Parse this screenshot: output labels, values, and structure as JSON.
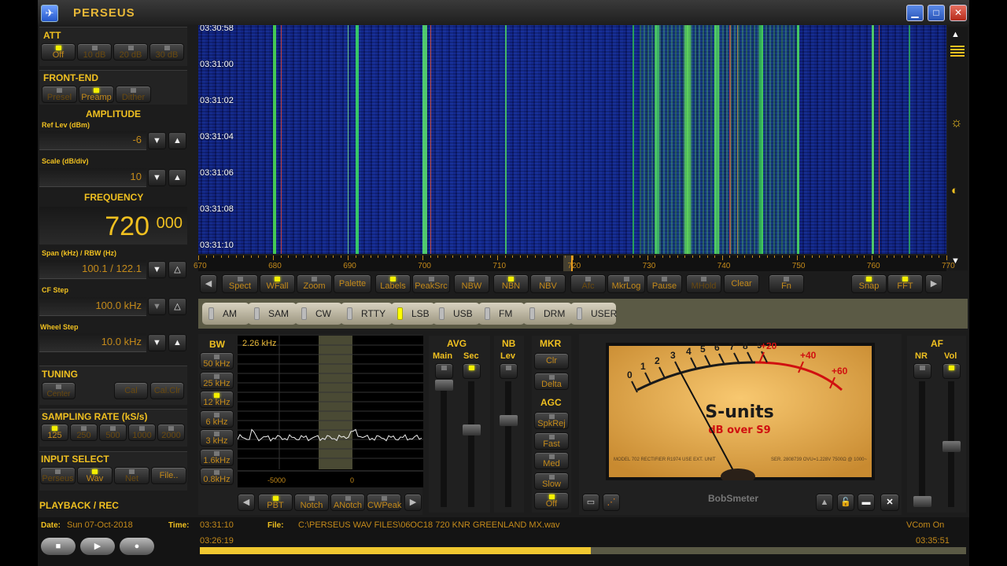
{
  "app": {
    "title": "PERSEUS",
    "icon": "app-logo-icon",
    "window_buttons": [
      "minimize",
      "maximize",
      "close"
    ]
  },
  "left": {
    "att": {
      "title": "ATT",
      "buttons": [
        {
          "label": "Off",
          "on": true
        },
        {
          "label": "10 dB",
          "on": false
        },
        {
          "label": "20 dB",
          "on": false
        },
        {
          "label": "30 dB",
          "on": false
        }
      ]
    },
    "frontend": {
      "title": "FRONT-END",
      "buttons": [
        {
          "label": "Presel",
          "on": false
        },
        {
          "label": "Preamp",
          "on": true
        },
        {
          "label": "Dither",
          "on": false
        }
      ]
    },
    "amplitude": {
      "title": "AMPLITUDE",
      "ref_label": "Ref Lev (dBm)",
      "ref_value": "-6",
      "scale_label": "Scale (dB/div)",
      "scale_value": "10"
    },
    "frequency": {
      "title": "FREQUENCY",
      "khz": "720",
      "hz": "000",
      "span_label": "Span (kHz) / RBW (Hz)",
      "span_value": "100.1 / 122.1",
      "cf_label": "CF Step",
      "cf_value": "100.0 kHz",
      "wheel_label": "Wheel Step",
      "wheel_value": "10.0 kHz"
    },
    "tuning": {
      "title": "TUNING",
      "buttons": [
        {
          "label": "Center"
        },
        {
          "label": "Cal"
        },
        {
          "label": "Cal.Clr"
        }
      ]
    },
    "sampling": {
      "title": "SAMPLING RATE (kS/s)",
      "buttons": [
        {
          "label": "125",
          "on": true
        },
        {
          "label": "250",
          "on": false
        },
        {
          "label": "500",
          "on": false
        },
        {
          "label": "1000",
          "on": false
        },
        {
          "label": "2000",
          "on": false
        }
      ]
    },
    "input": {
      "title": "INPUT SELECT",
      "buttons": [
        {
          "label": "Perseus",
          "on": false
        },
        {
          "label": "Wav",
          "on": true
        },
        {
          "label": "Net",
          "on": false
        },
        {
          "label": "File.."
        }
      ]
    },
    "playback": {
      "title": "PLAYBACK / REC"
    }
  },
  "waterfall": {
    "times": [
      "03:30:58",
      "03:31:00",
      "03:31:02",
      "03:31:04",
      "03:31:06",
      "03:31:08",
      "03:31:10"
    ],
    "freq_ticks": [
      "670",
      "680",
      "690",
      "700",
      "710",
      "720",
      "730",
      "740",
      "750",
      "760",
      "770"
    ],
    "tuned_khz": 720
  },
  "toolbar": [
    {
      "label": "Spect",
      "on": false
    },
    {
      "label": "WFall",
      "on": true
    },
    {
      "label": "Zoom",
      "on": false
    },
    {
      "label": "Palette"
    },
    {
      "label": "Labels",
      "on": true
    },
    {
      "label": "PeakSrc",
      "on": false
    },
    {
      "label": "NBW",
      "on": false
    },
    {
      "label": "NBN",
      "on": true
    },
    {
      "label": "NBV",
      "on": false
    },
    {
      "label": "Afc",
      "on": false,
      "dim": true
    },
    {
      "label": "MkrLog",
      "on": false
    },
    {
      "label": "Pause",
      "on": false
    },
    {
      "label": "MHold",
      "on": false,
      "dim": true
    },
    {
      "label": "Clear"
    },
    {
      "label": "Fn",
      "on": false
    },
    {
      "label": "Snap",
      "on": true
    },
    {
      "label": "FFT",
      "on": true
    }
  ],
  "modes": [
    {
      "label": "AM",
      "on": false
    },
    {
      "label": "SAM",
      "on": false
    },
    {
      "label": "CW",
      "on": false
    },
    {
      "label": "RTTY",
      "on": false
    },
    {
      "label": "LSB",
      "on": true
    },
    {
      "label": "USB",
      "on": false
    },
    {
      "label": "FM",
      "on": false
    },
    {
      "label": "DRM",
      "on": false
    },
    {
      "label": "USER",
      "on": false
    }
  ],
  "bw": {
    "title": "BW",
    "value": "2.26 kHz",
    "buttons": [
      {
        "label": "50 kHz",
        "on": false
      },
      {
        "label": "25 kHz",
        "on": false
      },
      {
        "label": "12 kHz",
        "on": true
      },
      {
        "label": "6 kHz",
        "on": false
      },
      {
        "label": "3 kHz",
        "on": false
      },
      {
        "label": "1.6kHz",
        "on": false
      },
      {
        "label": "0.8kHz",
        "on": false
      }
    ],
    "axis": [
      "-5000",
      "0"
    ],
    "filter_buttons": [
      {
        "label": "PBT",
        "on": true
      },
      {
        "label": "Notch",
        "on": false
      },
      {
        "label": "ANotch",
        "on": false
      },
      {
        "label": "CWPeak",
        "on": false
      }
    ]
  },
  "avg": {
    "title": "AVG",
    "main": "Main",
    "sec": "Sec",
    "sec_on": true
  },
  "nb": {
    "title": "NB",
    "lev": "Lev"
  },
  "mkr": {
    "title": "MKR",
    "buttons": [
      {
        "label": "Clr"
      },
      {
        "label": "Delta",
        "on": false
      }
    ]
  },
  "agc": {
    "title": "AGC",
    "buttons": [
      {
        "label": "SpkRej",
        "on": false
      },
      {
        "label": "Fast",
        "on": false
      },
      {
        "label": "Med",
        "on": false
      },
      {
        "label": "Slow",
        "on": false
      },
      {
        "label": "Off",
        "on": true
      }
    ]
  },
  "smeter": {
    "scale": [
      "0",
      "1",
      "2",
      "3",
      "4",
      "5",
      "6",
      "7",
      "8",
      "9"
    ],
    "over": [
      "+20",
      "+40",
      "+60"
    ],
    "title": "S-units",
    "subtitle": "dB over S9",
    "plate_left": "MODEL 702 RECTIFIER R1974 USE EXT. UNIT",
    "plate_right": "SER. 2808739 OVU=1.228V 7500Ω @ 1000~",
    "name": "BobSmeter",
    "reading_s": 4
  },
  "af": {
    "title": "AF",
    "nr": "NR",
    "vol": "Vol",
    "vol_on": true
  },
  "status": {
    "date_label": "Date:",
    "date": "Sun 07-Oct-2018",
    "time_label": "Time:",
    "time": "03:31:10",
    "file_label": "File:",
    "file": "C:\\PERSEUS WAV FILES\\06OC18 720 KNR GREENLAND MX.wav",
    "vcom": "VCom On",
    "start": "03:26:19",
    "end": "03:35:51",
    "progress": 0.51
  },
  "colors": {
    "accent": "#f0c020",
    "led_on": "#f4f000",
    "waterfall_bg": "#0d2080"
  }
}
